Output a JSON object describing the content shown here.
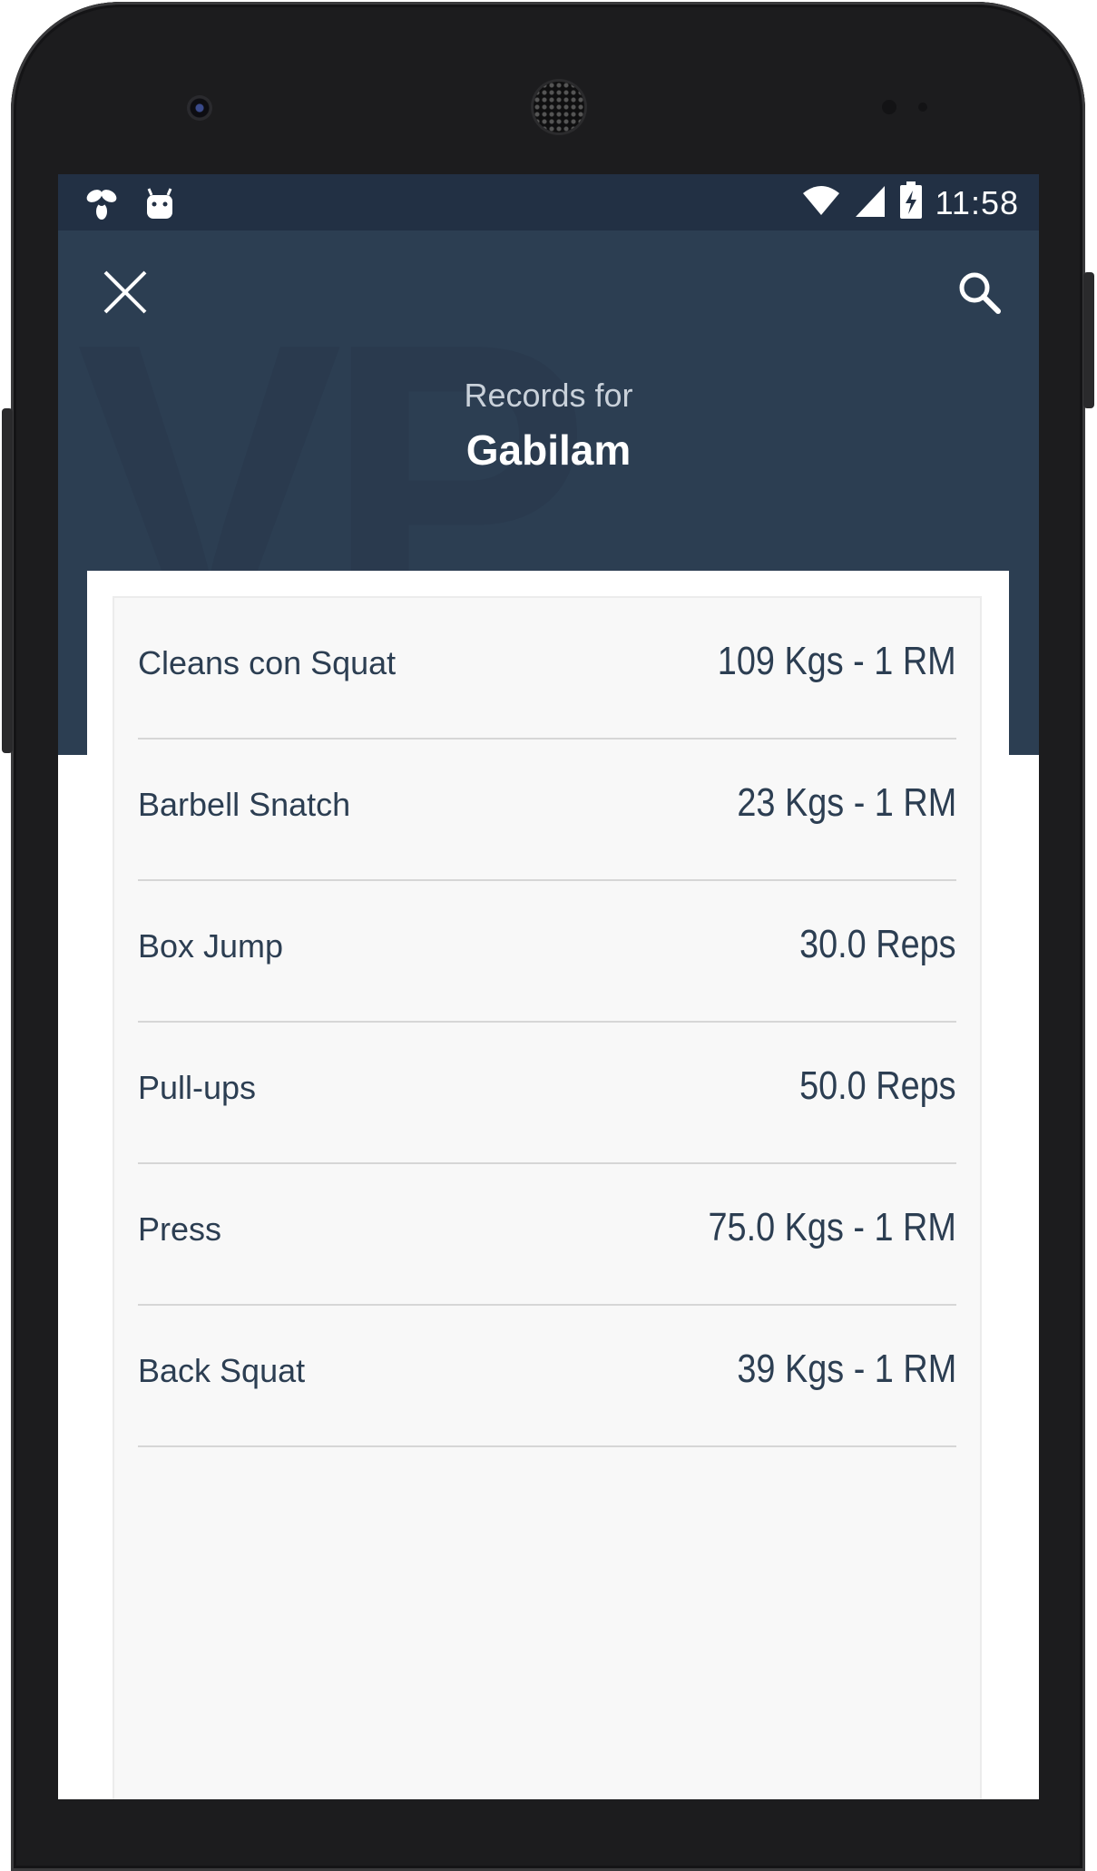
{
  "status_bar": {
    "time": "11:58",
    "left_icons": [
      "pinwheel-icon",
      "android-icon"
    ],
    "right_icons": [
      "wifi-icon",
      "cell-signal-icon",
      "battery-charging-icon"
    ]
  },
  "header": {
    "subtitle": "Records for",
    "title": "Gabilam",
    "close_icon": "close-icon",
    "search_icon": "search-icon"
  },
  "records": [
    {
      "name": "Cleans con Squat",
      "value": "109 Kgs - 1 RM"
    },
    {
      "name": "Barbell Snatch",
      "value": "23 Kgs - 1 RM"
    },
    {
      "name": "Box Jump",
      "value": "30.0 Reps"
    },
    {
      "name": "Pull-ups",
      "value": "50.0 Reps"
    },
    {
      "name": "Press",
      "value": "75.0 Kgs - 1 RM"
    },
    {
      "name": "Back Squat",
      "value": "39 Kgs - 1 RM"
    }
  ],
  "colors": {
    "status_bar": "#223044",
    "header": "#2c3e52",
    "list_background": "#f8f8f8",
    "text": "#2c3e52"
  }
}
